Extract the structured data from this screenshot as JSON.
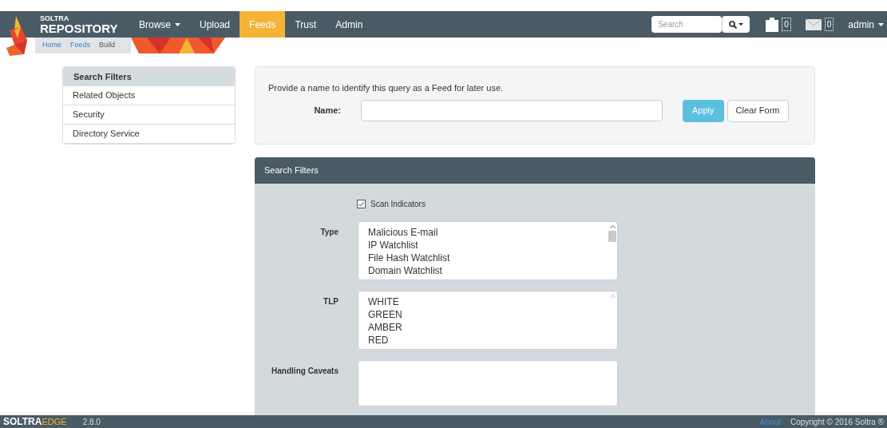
{
  "navbar": {
    "brand_top": "SOLTRA",
    "brand_bottom": "REPOSITORY",
    "items": [
      {
        "label": "Browse",
        "dropdown": true,
        "selected": false
      },
      {
        "label": "Upload",
        "dropdown": false,
        "selected": false
      },
      {
        "label": "Feeds",
        "dropdown": false,
        "selected": true
      },
      {
        "label": "Trust",
        "dropdown": false,
        "selected": false
      },
      {
        "label": "Admin",
        "dropdown": false,
        "selected": false
      }
    ],
    "search": {
      "placeholder": "Search"
    },
    "clipboard_count": "0",
    "messages_count": "0",
    "user": "admin"
  },
  "breadcrumb": [
    "Home",
    "Feeds",
    "Build"
  ],
  "sidebar": {
    "items": [
      {
        "label": "Search Filters",
        "selected": true
      },
      {
        "label": "Related Objects",
        "selected": false
      },
      {
        "label": "Security",
        "selected": false
      },
      {
        "label": "Directory Service",
        "selected": false
      }
    ]
  },
  "feed_form": {
    "intro": "Provide a name to identify this query as a Feed for later use.",
    "name_label": "Name:",
    "apply": "Apply",
    "clear": "Clear Form"
  },
  "filters": {
    "title": "Search Filters",
    "scan_indicators": {
      "label": "Scan Indicators",
      "checked": true
    },
    "type": {
      "label": "Type",
      "options": [
        "Malicious E-mail",
        "IP Watchlist",
        "File Hash Watchlist",
        "Domain Watchlist"
      ]
    },
    "tlp": {
      "label": "TLP",
      "options": [
        "WHITE",
        "GREEN",
        "AMBER",
        "RED"
      ]
    },
    "handling_caveats": {
      "label": "Handling Caveats"
    }
  },
  "footer": {
    "brand": "SOLTRA",
    "brand_suffix": "EDGE",
    "version": "2.8.0",
    "about": "About",
    "copyright": "Copyright © 2016 Soltra ®"
  }
}
